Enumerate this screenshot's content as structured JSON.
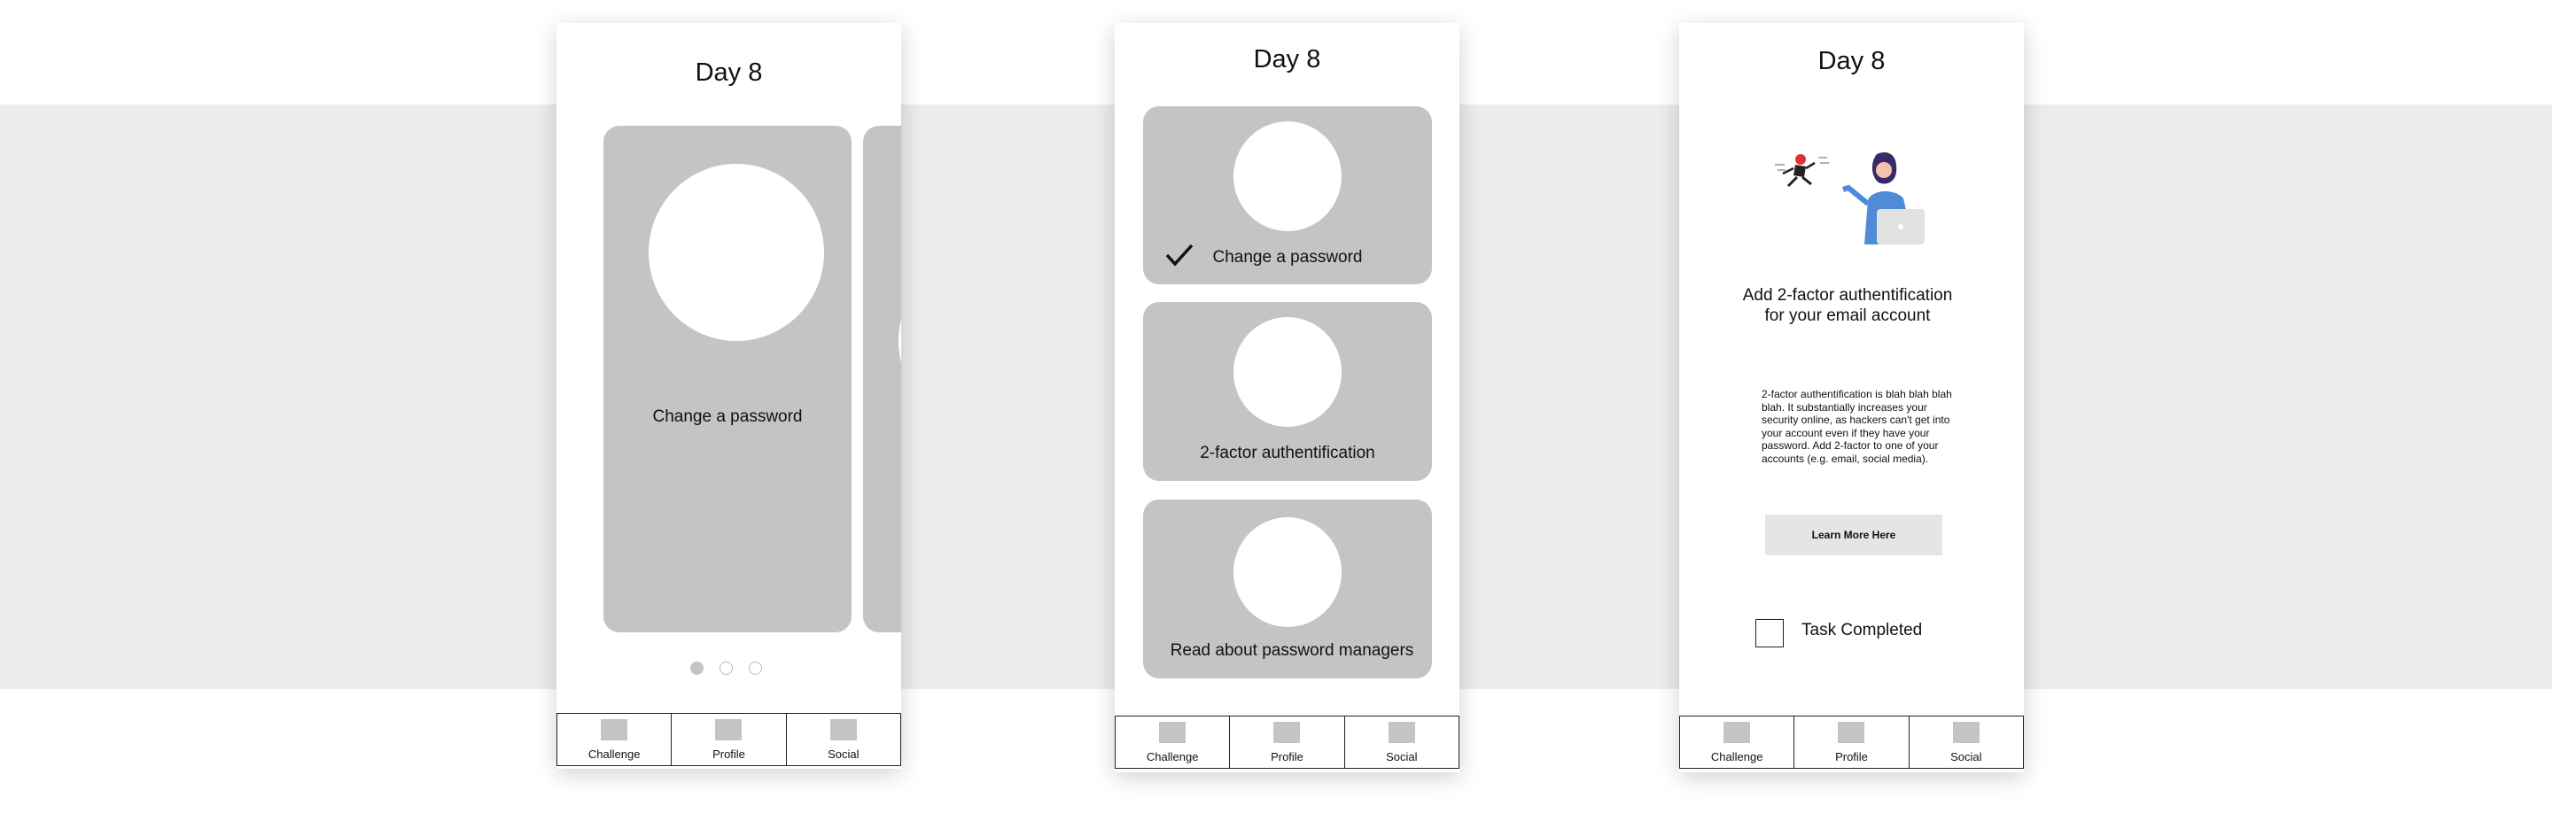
{
  "screens": [
    {
      "title": "Day 8",
      "card_label": "Change a password",
      "pagination": {
        "total": 3,
        "active": 1
      }
    },
    {
      "title": "Day 8",
      "cards": [
        {
          "label": "Change a password",
          "completed": true
        },
        {
          "label": "2-factor authentification",
          "completed": false
        },
        {
          "label": "Read about password managers",
          "completed": false
        }
      ]
    },
    {
      "title": "Day 8",
      "heading_line1": "Add 2-factor authentification",
      "heading_line2": "for your email account",
      "body_text": "2-factor authentification is blah blah blah blah. It substantially increases your security online, as hackers can't get into your account even if they have your password. Add 2-factor to one of your accounts (e.g. email, social media).",
      "learn_more_label": "Learn More Here",
      "task_label": "Task Completed",
      "task_checked": false
    }
  ],
  "nav": {
    "items": [
      {
        "label": "Challenge",
        "icon": "placeholder-icon"
      },
      {
        "label": "Profile",
        "icon": "placeholder-icon"
      },
      {
        "label": "Social",
        "icon": "placeholder-icon"
      }
    ]
  },
  "colors": {
    "card_gray": "#c4c4c4",
    "band_gray": "#ececee",
    "button_gray": "#e5e5e5"
  }
}
